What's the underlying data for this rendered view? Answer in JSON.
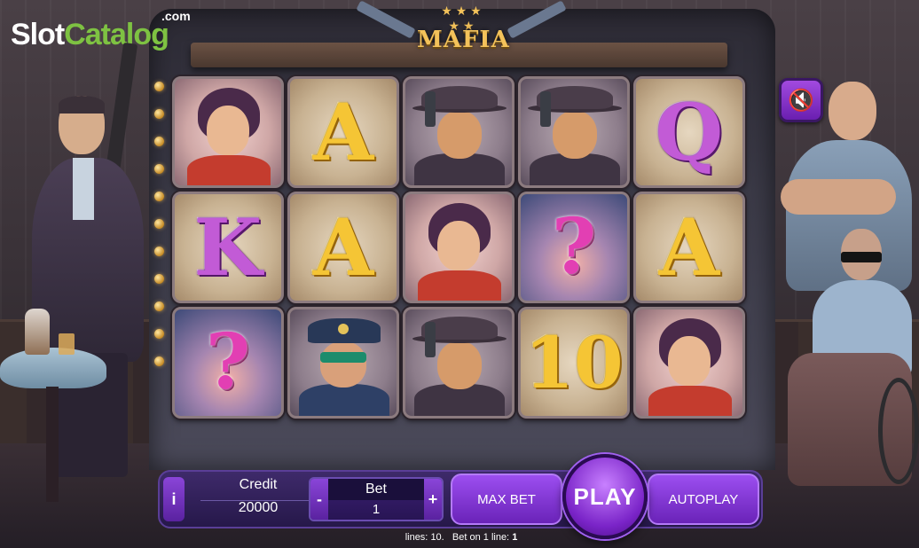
{
  "watermark": {
    "brand_slot": "Slot",
    "brand_catalog": "Catalog",
    "brand_suffix": ".com"
  },
  "game": {
    "title": "MAFIA",
    "title_stars": "★ ★ ★ ★ ★"
  },
  "reels": [
    [
      {
        "symbol": "woman",
        "label": ""
      },
      {
        "symbol": "A",
        "label": "A",
        "style": "gold"
      },
      {
        "symbol": "gangster",
        "label": ""
      },
      {
        "symbol": "gangster",
        "label": ""
      },
      {
        "symbol": "Q",
        "label": "Q",
        "style": "purple"
      }
    ],
    [
      {
        "symbol": "K",
        "label": "K",
        "style": "purple"
      },
      {
        "symbol": "A",
        "label": "A",
        "style": "gold"
      },
      {
        "symbol": "woman",
        "label": ""
      },
      {
        "symbol": "mystery",
        "label": "?",
        "style": "mystery"
      },
      {
        "symbol": "A",
        "label": "A",
        "style": "gold"
      }
    ],
    [
      {
        "symbol": "mystery",
        "label": "?",
        "style": "mystery"
      },
      {
        "symbol": "policeman",
        "label": ""
      },
      {
        "symbol": "gangster",
        "label": ""
      },
      {
        "symbol": "10",
        "label": "10",
        "style": "gold"
      },
      {
        "symbol": "woman",
        "label": ""
      }
    ]
  ],
  "sound": {
    "icon": "mute-icon",
    "glyph": "🔇"
  },
  "controls": {
    "info_label": "i",
    "credit_label": "Credit",
    "credit_value": "20000",
    "bet_minus": "-",
    "bet_plus": "+",
    "bet_label": "Bet",
    "bet_value": "1",
    "max_bet_label": "MAX BET",
    "play_label": "PLAY",
    "autoplay_label": "AUTOPLAY"
  },
  "footer": {
    "lines_label": "lines:",
    "lines_value": "10.",
    "bet_per_line_label": "Bet on 1 line:",
    "bet_per_line_value": "1"
  },
  "colors": {
    "accent": "#8a45d8",
    "gold": "#f5c535",
    "brand_green": "#7ec242"
  }
}
